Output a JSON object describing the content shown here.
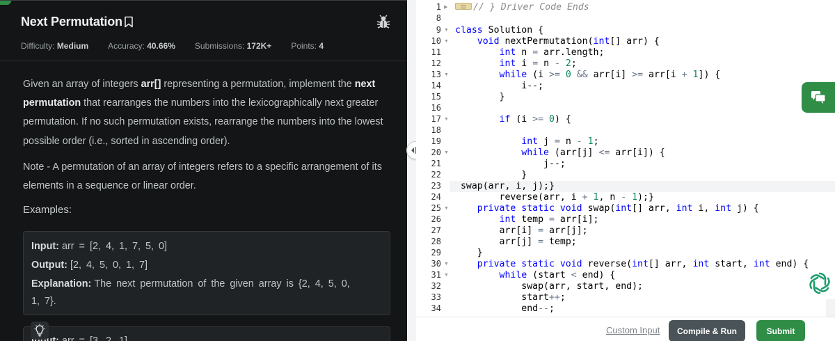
{
  "problem": {
    "title": "Next Permutation",
    "meta": {
      "difficulty_label": "Difficulty:",
      "difficulty_value": "Medium",
      "accuracy_label": "Accuracy:",
      "accuracy_value": "40.66%",
      "submissions_label": "Submissions:",
      "submissions_value": "172K+",
      "points_label": "Points:",
      "points_value": "4"
    },
    "description": {
      "p1_a": "Given an array of integers ",
      "p1_b": "arr[]",
      "p1_c": " representing a permutation, implement the ",
      "p1_d": "next permutation",
      "p1_e": " that rearranges the numbers into the lexicographically next greater permutation. If no such permutation exists, rearrange the numbers into the lowest possible order (i.e., sorted in ascending order).",
      "note": "Note - A permutation of an array of integers refers to a specific arrangement of its elements in a sequence or linear order."
    },
    "examples_label": "Examples:",
    "example1": {
      "input_label": "Input:",
      "input_value": "arr = [2, 4, 1, 7, 5, 0]",
      "output_label": "Output:",
      "output_value": "[2, 4, 5, 0, 1, 7]",
      "explanation_label": "Explanation:",
      "explanation_line1": "The next permutation of the given array is {2, 4, 5, 0,",
      "explanation_line2": "1, 7}."
    },
    "example2": {
      "input_label": "Input:",
      "input_value": "arr = [3, 2, 1]"
    }
  },
  "editor": {
    "line_numbers": [
      "1",
      "8",
      "9",
      "10",
      "11",
      "12",
      "13",
      "14",
      "15",
      "16",
      "17",
      "18",
      "19",
      "20",
      "21",
      "22",
      "23",
      "24",
      "25",
      "26",
      "27",
      "28",
      "29",
      "30",
      "31",
      "32",
      "33",
      "34"
    ],
    "active_line": "23",
    "code": {
      "l1": "// } Driver Code Ends",
      "l9_kw": "class",
      "l9_rest": " Solution {",
      "l10_kw": "void",
      "l10_a": " nextPermutation(",
      "l10_kw2": "int",
      "l10_b": "[] arr) {",
      "l11_kw": "int",
      "l11_a": " n ",
      "l11_op": "=",
      "l11_b": " arr.length;",
      "l12_kw": "int",
      "l12_a": " i ",
      "l12_op": "=",
      "l12_b": " n ",
      "l12_op2": "-",
      "l12_num": "2",
      "l12_c": ";",
      "l13_kw": "while",
      "l13_a": " (i ",
      "l13_op": ">=",
      "l13_num": "0",
      "l13_op2": "&&",
      "l13_b": " arr[i] ",
      "l13_op3": ">=",
      "l13_c": " arr[i ",
      "l13_op4": "+",
      "l13_num2": "1",
      "l13_d": "]) {",
      "l14": "i--;",
      "l15": "}",
      "l17_kw": "if",
      "l17_a": " (i ",
      "l17_op": ">=",
      "l17_num": "0",
      "l17_b": ") {",
      "l19_kw": "int",
      "l19_a": " j ",
      "l19_op": "=",
      "l19_b": " n ",
      "l19_op2": "-",
      "l19_num": "1",
      "l19_c": ";",
      "l20_kw": "while",
      "l20_a": " (arr[j] ",
      "l20_op": "<=",
      "l20_b": " arr[i]) {",
      "l21": "j--;",
      "l22": "}",
      "l23": "swap(arr, i, j);}",
      "l24_a": "reverse(arr, i ",
      "l24_op": "+",
      "l24_num": "1",
      "l24_b": ", n ",
      "l24_op2": "-",
      "l24_num2": "1",
      "l24_c": ");}",
      "l25_kw": "private static void",
      "l25_a": " swap(",
      "l25_kw2": "int",
      "l25_b": "[] arr, ",
      "l25_kw3": "int",
      "l25_c": " i, ",
      "l25_kw4": "int",
      "l25_d": " j) {",
      "l26_kw": "int",
      "l26_a": " temp ",
      "l26_op": "=",
      "l26_b": " arr[i];",
      "l27_a": "arr[i] ",
      "l27_op": "=",
      "l27_b": " arr[j];",
      "l28_a": "arr[j] ",
      "l28_op": "=",
      "l28_b": " temp;",
      "l29": "}",
      "l30_kw": "private static void",
      "l30_a": " reverse(",
      "l30_kw2": "int",
      "l30_b": "[] arr, ",
      "l30_kw3": "int",
      "l30_c": " start, ",
      "l30_kw4": "int",
      "l30_d": " end) {",
      "l31_kw": "while",
      "l31_a": " (start ",
      "l31_op": "<",
      "l31_b": " end) {",
      "l32": "swap(arr, start, end);",
      "l33_a": "start",
      "l33_op": "++",
      "l33_b": ";",
      "l34_a": "end",
      "l34_op": "--",
      "l34_b": ";"
    }
  },
  "footer": {
    "custom_input": "Custom Input",
    "compile_run": "Compile & Run",
    "submit": "Submit"
  },
  "colors": {
    "brand_green": "#2f8d46",
    "panel_bg": "#131516",
    "run_button": "#4a5357"
  },
  "icons": [
    "bookmark-icon",
    "bug-icon",
    "split-handle-icon",
    "lightbulb-icon",
    "chat-icon",
    "ai-assistant-icon"
  ]
}
